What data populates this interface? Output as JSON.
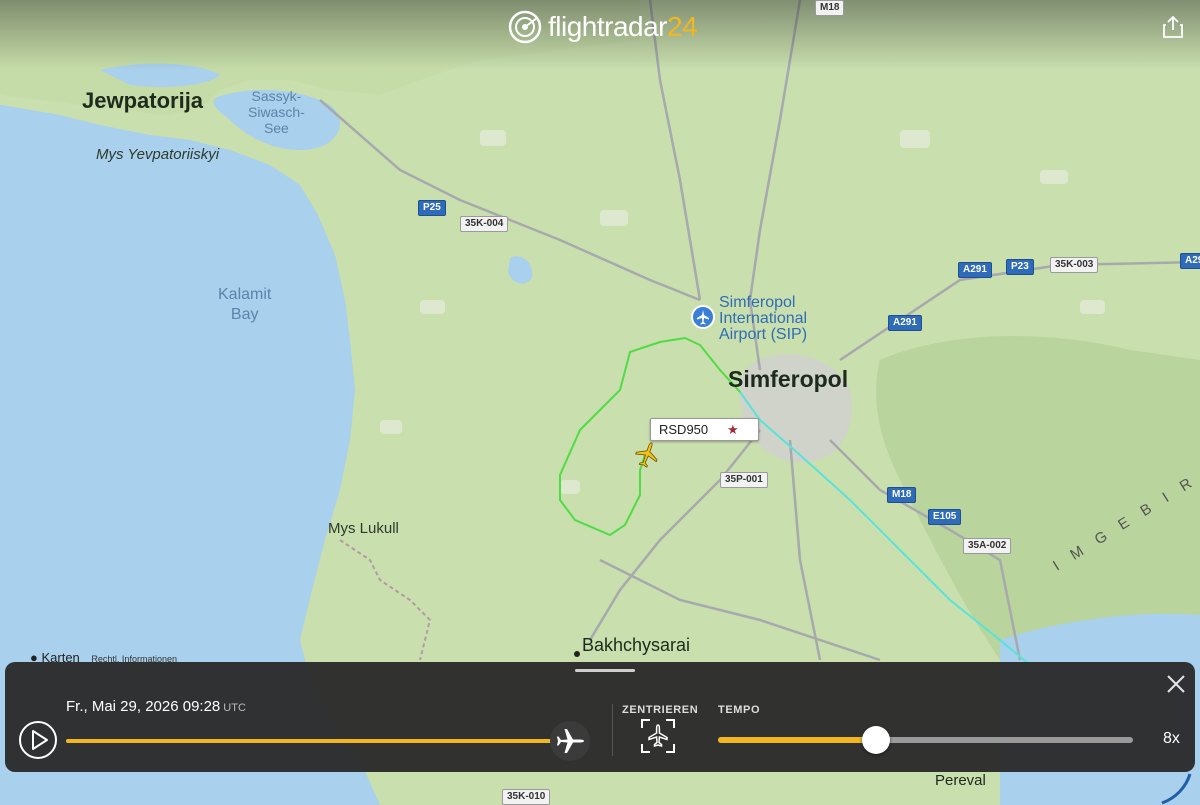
{
  "app": {
    "logo_word": "flightradar",
    "logo_number": "24"
  },
  "map": {
    "labels": {
      "jewpatorija": "Jewpatorija",
      "sassyk": "Sassyk-\nSiwasch-\nSee",
      "mys_yevpatoriiskyi": "Mys Yevpatoriiskyi",
      "kalamit_bay": "Kalamit\nBay",
      "mys_lukull": "Mys Lukull",
      "bakhchysarai": "Bakhchysarai",
      "simferopol": "Simferopol",
      "airport": "Simferopol\nInternational\nAirport (SIP)",
      "pereval": "Pereval",
      "range": "I M G E B I R"
    },
    "roads": {
      "m18_top": "M18",
      "p25": "P25",
      "r35k004": "35K-004",
      "a291_1": "A291",
      "p23": "P23",
      "r35k003": "35K-003",
      "a291_2": "A291",
      "a29_edge": "A29",
      "r35p001": "35P-001",
      "m18": "M18",
      "e105": "E105",
      "r35a002": "35A-002",
      "r35k010": "35K-010"
    },
    "attribution": {
      "brand": "Karten",
      "legal": "Rechtl. Informationen"
    }
  },
  "flight": {
    "callsign": "RSD950",
    "star": "★"
  },
  "playback": {
    "date": "Fr., Mai 29, 2026",
    "time": "09:28",
    "tz": "UTC",
    "progress": 1.0,
    "center_label": "ZENTRIEREN",
    "tempo_label": "TEMPO",
    "tempo_value": "8x",
    "tempo_level": 0.38
  },
  "colors": {
    "accent": "#f2b61f",
    "track_green": "#4fdc45",
    "track_cyan": "#59e3d9"
  },
  "icons": [
    "share-icon",
    "airport-icon",
    "plane-icon",
    "close-icon",
    "play-icon",
    "center-icon",
    "location-icon"
  ]
}
